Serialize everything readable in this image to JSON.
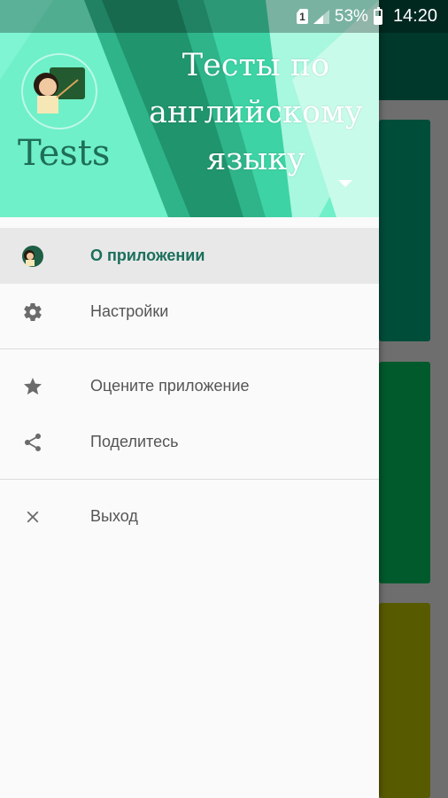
{
  "status_bar": {
    "sim": "1",
    "battery_percent": "53%",
    "time": "14:20"
  },
  "drawer": {
    "header": {
      "app_name": "Tests",
      "title": "Тесты по английскому языку"
    },
    "items": [
      {
        "label": "О приложении",
        "icon": "app-avatar-icon",
        "active": true
      },
      {
        "label": "Настройки",
        "icon": "gear-icon",
        "active": false
      },
      {
        "label": "Оцените приложение",
        "icon": "star-icon",
        "active": false
      },
      {
        "label": "Поделитесь",
        "icon": "share-icon",
        "active": false
      },
      {
        "label": "Выход",
        "icon": "close-icon",
        "active": false
      }
    ]
  },
  "colors": {
    "header_accent": "#6ff0c8",
    "active_text": "#1b6f5c"
  }
}
